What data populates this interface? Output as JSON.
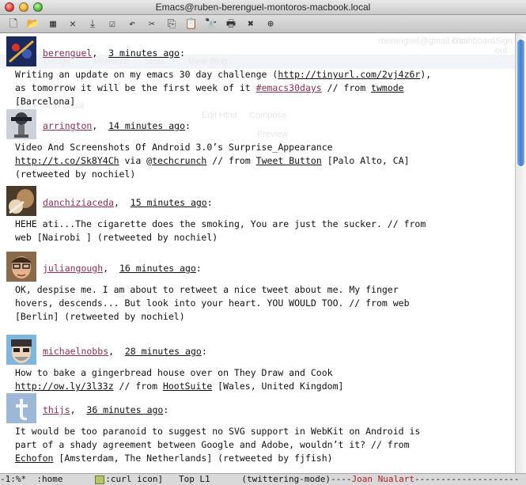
{
  "window": {
    "title": "Emacs@ruben-berenguel-montoros-macbook.local"
  },
  "toolbar": {
    "buttons": [
      {
        "name": "new-file-icon",
        "glyph": "🗋"
      },
      {
        "name": "open-folder-icon",
        "glyph": "📂"
      },
      {
        "name": "dired-icon",
        "glyph": "▦"
      },
      {
        "name": "close-buffer-icon",
        "glyph": "✕"
      },
      {
        "name": "save-icon",
        "glyph": "⤓"
      },
      {
        "name": "save-as-icon",
        "glyph": "☑"
      },
      {
        "name": "undo-icon",
        "glyph": "↶"
      },
      {
        "name": "cut-icon",
        "glyph": "✂"
      },
      {
        "name": "copy-icon",
        "glyph": "⎘"
      },
      {
        "name": "paste-icon",
        "glyph": "📋"
      },
      {
        "name": "search-icon",
        "glyph": "🔭"
      },
      {
        "name": "print-icon",
        "glyph": "🖶"
      },
      {
        "name": "preferences-icon",
        "glyph": "✖"
      },
      {
        "name": "help-icon",
        "glyph": "⊕"
      }
    ]
  },
  "background_ghost": {
    "email": "rberenguel@gmail.com",
    "dashboard": "Dashboard",
    "sign_out": "Sign out",
    "tabs": [
      "Design",
      "Monetize",
      "Stats",
      "View Blog"
    ],
    "edit_post": "Edit Post in Cahill",
    "edit_html": "Edit Html",
    "compose": "Compose",
    "preview": "Preview"
  },
  "tweets": [
    {
      "user": "berenguel",
      "time": "3 minutes ago",
      "lines": [
        [
          {
            "t": "Writing an update on my emacs 30 day challenge ("
          },
          {
            "t": "http://tinyurl.com/2vj4z6r",
            "c": "link"
          },
          {
            "t": "),"
          }
        ],
        [
          {
            "t": "as tomorrow it will be the first week of it "
          },
          {
            "t": "#emacs30days",
            "c": "hashtag"
          },
          {
            "t": " // from "
          },
          {
            "t": "twmode",
            "c": "link"
          }
        ],
        [
          {
            "t": "[Barcelona]"
          }
        ]
      ]
    },
    {
      "user": "arrington",
      "time": "14 minutes ago",
      "lines": [
        [
          {
            "t": "Video And Screenshots Of Android 3.0’s Surprise_Appearance"
          }
        ],
        [
          {
            "t": "http://t.co/Sk8Y4Ch",
            "c": "link"
          },
          {
            "t": " via @"
          },
          {
            "t": "techcrunch",
            "c": "link"
          },
          {
            "t": " // from "
          },
          {
            "t": "Tweet Button",
            "c": "link"
          },
          {
            "t": " [Palo Alto, CA]"
          }
        ],
        [
          {
            "t": "(retweeted by nochiel)"
          }
        ]
      ]
    },
    {
      "user": "danchiziaceda",
      "time": "15 minutes ago",
      "lines": [
        [
          {
            "t": "HEHE ati...The cigarette does the smoking, You are just the sucker. // from"
          }
        ],
        [
          {
            "t": "web [Nairobi ] (retweeted by nochiel)"
          }
        ]
      ]
    },
    {
      "user": "juliangough",
      "time": "16 minutes ago",
      "lines": [
        [
          {
            "t": "OK, despise me. I am about to retweet a nice tweet about me. My finger"
          }
        ],
        [
          {
            "t": "hovers, descends... But look into your heart. YOU WOULD TOO. // from web"
          }
        ],
        [
          {
            "t": "[Berlin] (retweeted by nochiel)"
          }
        ]
      ]
    },
    {
      "user": "michaelnobbs",
      "time": "28 minutes ago",
      "lines": [
        [
          {
            "t": "How to bake a gingerbread house over on They Draw and Cook"
          }
        ],
        [
          {
            "t": "http://ow.ly/3l33z",
            "c": "link"
          },
          {
            "t": " // from "
          },
          {
            "t": "HootSuite",
            "c": "link"
          },
          {
            "t": " [Wales, United Kingdom]"
          }
        ]
      ]
    },
    {
      "user": "thijs",
      "time": "36 minutes ago",
      "lines": [
        [
          {
            "t": "It would be too paranoid to suggest no SVG support in WebKit on Android is"
          }
        ],
        [
          {
            "t": "part of a shady agreement between Google and Adobe, wouldn’t it? // from"
          }
        ],
        [
          {
            "t": "Echofon",
            "c": "link"
          },
          {
            "t": " [Amsterdam, The Netherlands] (retweeted by fjfish)"
          }
        ]
      ]
    }
  ],
  "modeline": {
    "left": "-1:%*  :home      ",
    "icon_label": ":curl icon]",
    "pos": "   Top L1      ",
    "mode": "(twittering-mode)----",
    "name": "Joan Nualart",
    "fill": "--------------------"
  }
}
